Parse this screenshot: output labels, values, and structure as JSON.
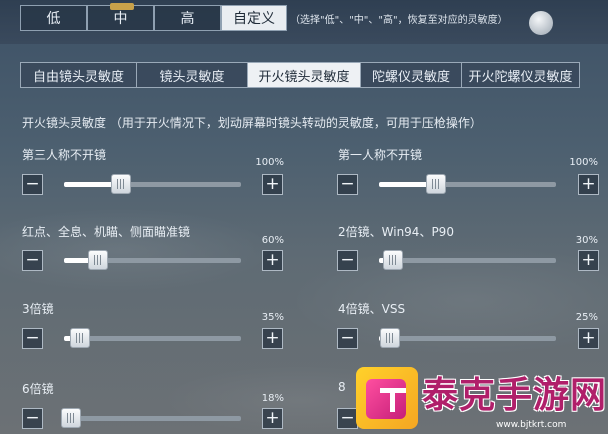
{
  "presets": {
    "items": [
      "低",
      "中",
      "高",
      "自定义"
    ],
    "active": 3,
    "hint": "（选择\"低\"、\"中\"、\"高\"，恢复至对应的灵敏度）"
  },
  "tabs": {
    "items": [
      "自由镜头灵敏度",
      "镜头灵敏度",
      "开火镜头灵敏度",
      "陀螺仪灵敏度",
      "开火陀螺仪灵敏度"
    ],
    "active": 2
  },
  "section": {
    "title": "开火镜头灵敏度 （用于开火情况下，划动屏幕时镜头转动的灵敏度，可用于压枪操作）"
  },
  "stepper": {
    "minus": "−",
    "plus": "+"
  },
  "sliders": {
    "third_person": {
      "label": "第三人称不开镜",
      "value_text": "100%",
      "level": 0.32
    },
    "first_person": {
      "label": "第一人称不开镜",
      "value_text": "100%",
      "level": 0.32
    },
    "red_dot": {
      "label": "红点、全息、机瞄、侧面瞄准镜",
      "value_text": "60%",
      "level": 0.19
    },
    "scope_2x": {
      "label": "2倍镜、Win94、P90",
      "value_text": "30%",
      "level": 0.08
    },
    "scope_3x": {
      "label": "3倍镜",
      "value_text": "35%",
      "level": 0.09
    },
    "scope_4x": {
      "label": "4倍镜、VSS",
      "value_text": "25%",
      "level": 0.06
    },
    "scope_6x": {
      "label": "6倍镜",
      "value_text": "18%",
      "level": 0.04
    },
    "scope_8x": {
      "label": "8"
    }
  },
  "watermark": {
    "name": "泰克手游网",
    "url": "www.bjtkrt.com"
  }
}
